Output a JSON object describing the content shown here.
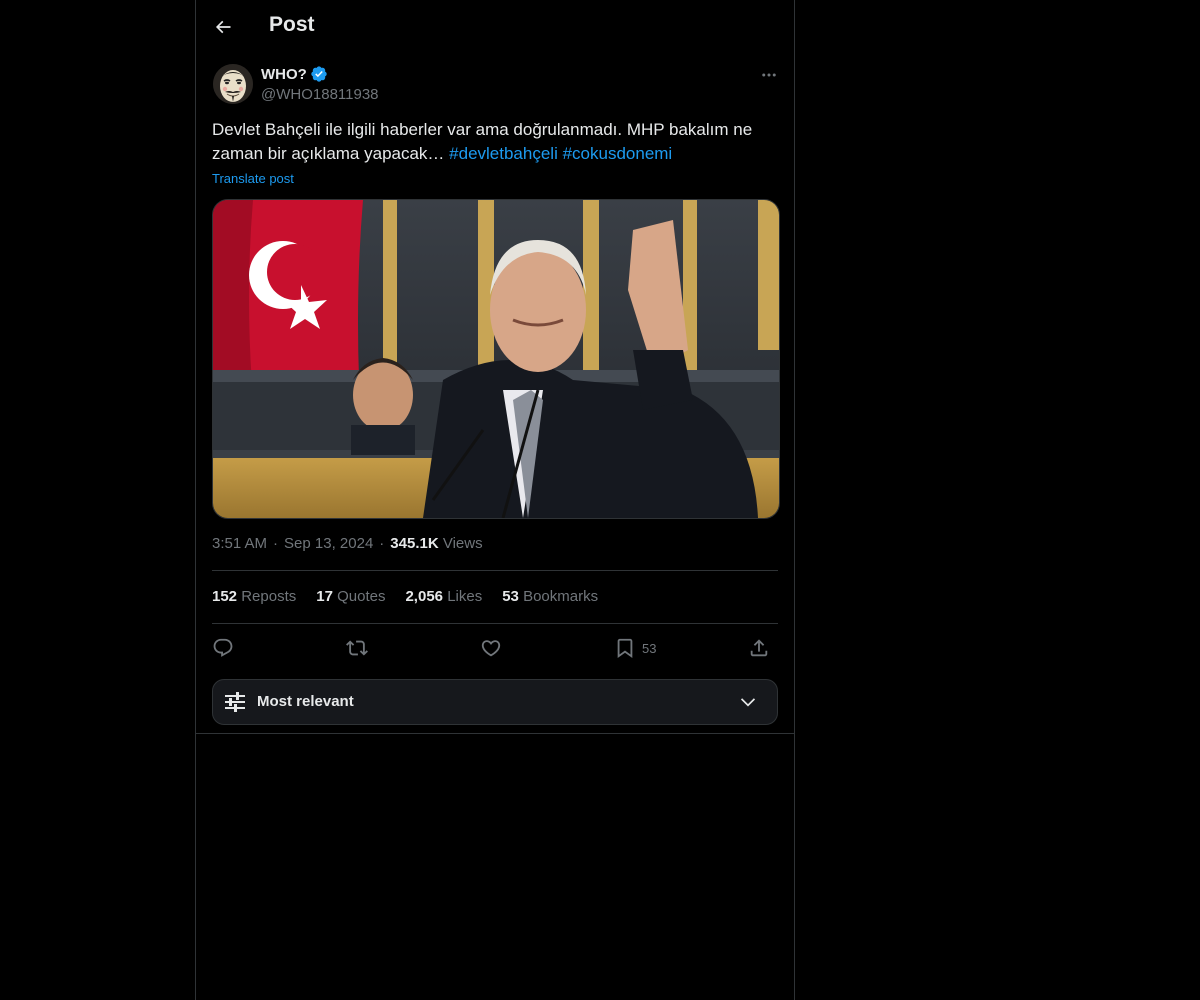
{
  "header": {
    "title": "Post",
    "back_icon": "arrow-left-icon"
  },
  "author": {
    "display_name": "WHO?",
    "handle": "@WHO18811938",
    "verified": true,
    "verified_color": "#1d9bf0",
    "avatar_icon": "guy-fawkes-mask-avatar"
  },
  "post": {
    "text_prefix": "Devlet Bahçeli ile ilgili haberler var ama doğrulanmadı. MHP bakalım ne zaman bir açıklama yapacak… ",
    "hashtags": [
      "#devletbahçeli",
      "#cokusdonemi"
    ],
    "translate_label": "Translate post",
    "time": "3:51 AM",
    "date": "Sep 13, 2024",
    "separator": "·",
    "views_count": "345.1K",
    "views_label": "Views"
  },
  "stats": {
    "reposts": {
      "count": "152",
      "label": "Reposts"
    },
    "quotes": {
      "count": "17",
      "label": "Quotes"
    },
    "likes": {
      "count": "2,056",
      "label": "Likes"
    },
    "bookmarks": {
      "count": "53",
      "label": "Bookmarks"
    }
  },
  "actions": {
    "reply_icon": "reply-icon",
    "repost_icon": "repost-icon",
    "like_icon": "heart-icon",
    "bookmark_icon": "bookmark-icon",
    "bookmark_count": "53",
    "share_icon": "share-icon"
  },
  "sort": {
    "label": "Most relevant",
    "icon": "sliders-icon",
    "chevron": "chevron-down-icon"
  },
  "colors": {
    "background": "#000000",
    "text_primary": "#e7e9ea",
    "text_secondary": "#71767b",
    "accent": "#1d9bf0",
    "border": "#2f3336"
  }
}
